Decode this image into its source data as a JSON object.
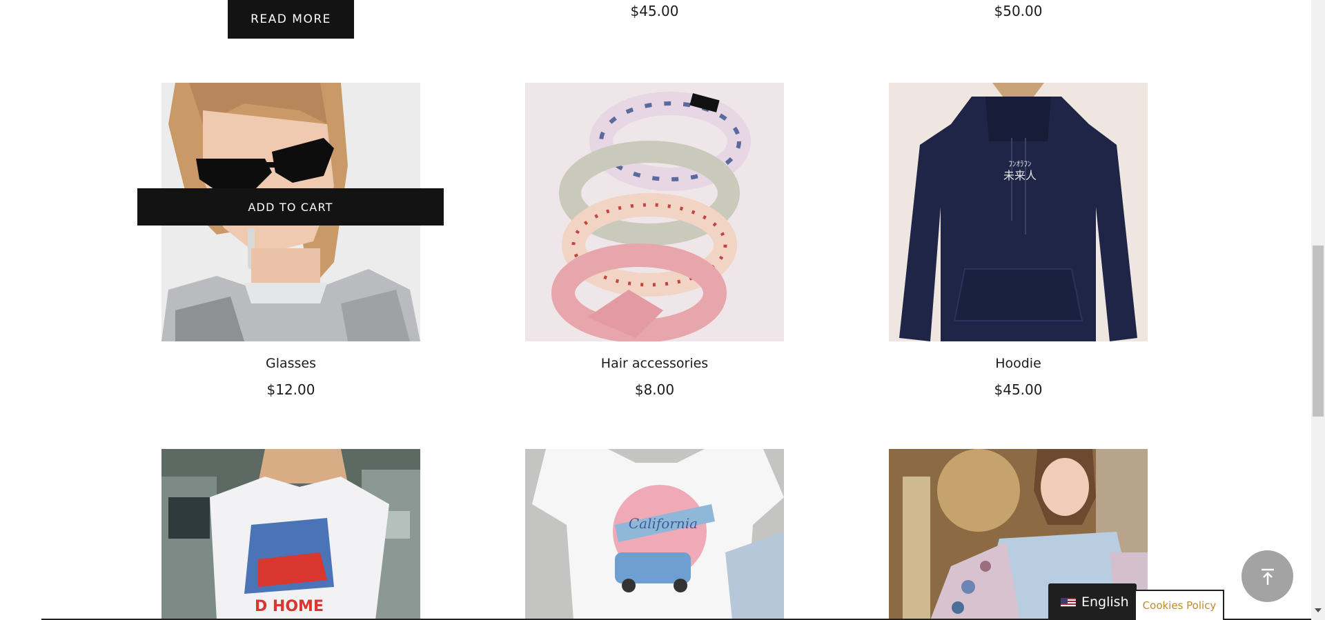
{
  "top_row": {
    "read_more_label": "READ MORE",
    "price_2": "$45.00",
    "price_3": "$50.00"
  },
  "products": [
    {
      "name": "Glasses",
      "price": "$12.00",
      "image": "woman with black sunglasses and silver top"
    },
    {
      "name": "Hair accessories",
      "price": "$8.00",
      "image": "stack of fabric headbands"
    },
    {
      "name": "Hoodie",
      "price": "$45.00",
      "image": "navy hoodie with japanese text"
    }
  ],
  "add_to_cart_label": "ADD TO CART",
  "bottom_row": [
    {
      "image": "woman in white graphic t-shirt"
    },
    {
      "image": "white california dreams t-shirt"
    },
    {
      "image": "woman in blue floral blouse"
    }
  ],
  "language": {
    "label": "English",
    "flag": "us-flag-icon"
  },
  "cookies_label": "Cookies Policy",
  "colors": {
    "button_bg": "#131313",
    "cookies_text": "#c08a2b",
    "to_top_bg": "#a3a3a3"
  }
}
